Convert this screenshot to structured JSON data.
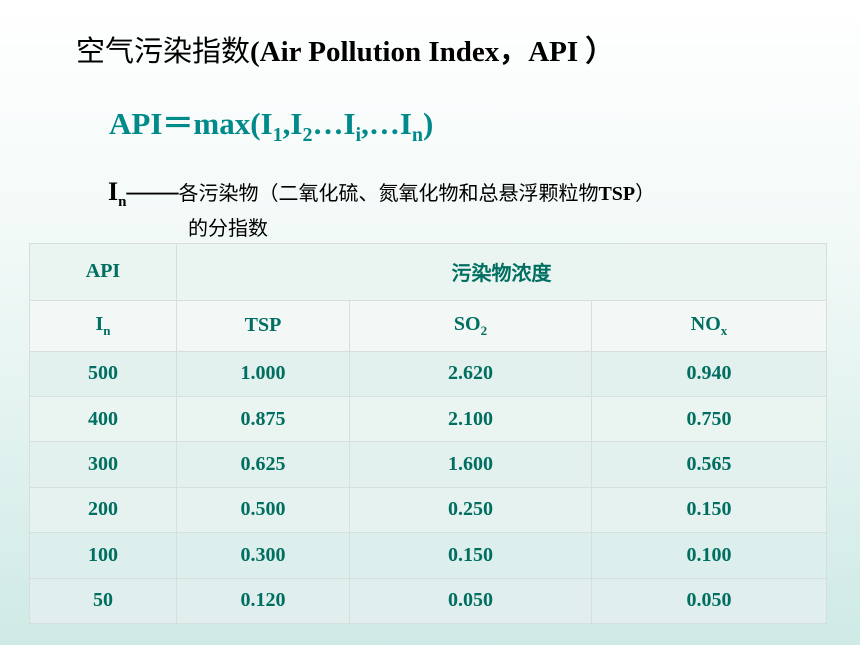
{
  "title": {
    "cjk": "空气污染指数",
    "latin": "(Air Pollution Index，API ）"
  },
  "formula": {
    "lhs": "API＝max(I",
    "s1": "1",
    "p1": ",I",
    "s2": "2",
    "p2": "…I",
    "s3": "i",
    "p3": ",…I",
    "s4": "n",
    "p4": ")"
  },
  "definition": {
    "symbol": "I",
    "symbol_sub": "n",
    "dash": "——",
    "text_a": "各污染物（二氧化硫、氮氧化物和总悬浮颗粒物",
    "text_tsp": "TSP",
    "text_b": "）",
    "line2": "的分指数"
  },
  "table": {
    "header_api": "API",
    "header_conc": "污染物浓度",
    "sub_in": "I",
    "sub_in_sub": "n",
    "sub_tsp": "TSP",
    "sub_so2": "SO",
    "sub_so2_sub": "2",
    "sub_nox": "NO",
    "sub_nox_sub": "x",
    "rows": [
      {
        "api": "500",
        "tsp": "1.000",
        "so2": "2.620",
        "nox": "0.940"
      },
      {
        "api": "400",
        "tsp": "0.875",
        "so2": "2.100",
        "nox": "0.750"
      },
      {
        "api": "300",
        "tsp": "0.625",
        "so2": "1.600",
        "nox": "0.565"
      },
      {
        "api": "200",
        "tsp": "0.500",
        "so2": "0.250",
        "nox": "0.150"
      },
      {
        "api": "100",
        "tsp": "0.300",
        "so2": "0.150",
        "nox": "0.100"
      },
      {
        "api": "50",
        "tsp": "0.120",
        "so2": "0.050",
        "nox": "0.050"
      }
    ]
  }
}
